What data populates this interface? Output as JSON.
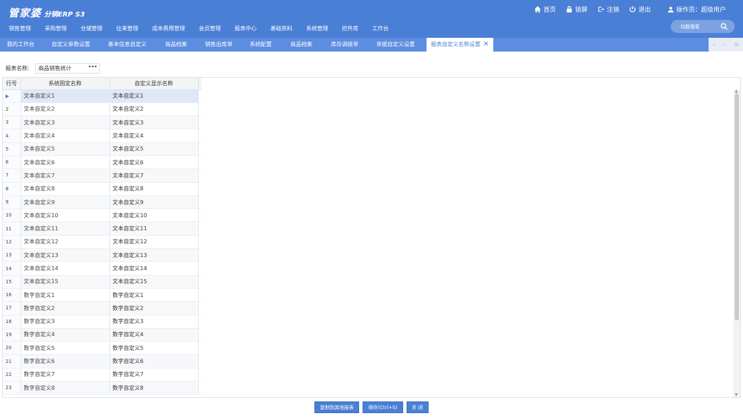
{
  "app": {
    "logo_main": "管家婆",
    "logo_sub": "分销ERP S3"
  },
  "top_links": [
    {
      "label": "首页",
      "icon": "home-icon"
    },
    {
      "label": "锁屏",
      "icon": "lock-icon"
    },
    {
      "label": "注销",
      "icon": "logout-icon"
    },
    {
      "label": "退出",
      "icon": "power-icon"
    }
  ],
  "operator": "操作员：超级用户",
  "main_menu": [
    "销售管理",
    "采购管理",
    "仓储管理",
    "往来管理",
    "成本费用管理",
    "会员管理",
    "报表中心",
    "基础资料",
    "系统管理",
    "控件库",
    "工作台"
  ],
  "search": {
    "placeholder": "功能搜索"
  },
  "tabs": [
    {
      "label": "我的工作台"
    },
    {
      "label": "自定义参数设置"
    },
    {
      "label": "基本信息自定义"
    },
    {
      "label": "商品档案"
    },
    {
      "label": "销售出库单"
    },
    {
      "label": "系统配置"
    },
    {
      "label": "商品档案"
    },
    {
      "label": "库存调拨单"
    },
    {
      "label": "单据自定义设置"
    },
    {
      "label": "报表自定义名称设置",
      "active": true
    }
  ],
  "filter": {
    "label": "报表名称:",
    "value": "商品销售统计",
    "dots": "•••"
  },
  "grid": {
    "headers": [
      "行号",
      "系统固定名称",
      "自定义显示名称"
    ],
    "selected_marker": "▶",
    "rows": [
      [
        "1",
        "文本自定义1",
        "文本自定义1"
      ],
      [
        "2",
        "文本自定义2",
        "文本自定义2"
      ],
      [
        "3",
        "文本自定义3",
        "文本自定义3"
      ],
      [
        "4",
        "文本自定义4",
        "文本自定义4"
      ],
      [
        "5",
        "文本自定义5",
        "文本自定义5"
      ],
      [
        "6",
        "文本自定义6",
        "文本自定义6"
      ],
      [
        "7",
        "文本自定义7",
        "文本自定义7"
      ],
      [
        "8",
        "文本自定义8",
        "文本自定义8"
      ],
      [
        "9",
        "文本自定义9",
        "文本自定义9"
      ],
      [
        "10",
        "文本自定义10",
        "文本自定义10"
      ],
      [
        "11",
        "文本自定义11",
        "文本自定义11"
      ],
      [
        "12",
        "文本自定义12",
        "文本自定义12"
      ],
      [
        "13",
        "文本自定义13",
        "文本自定义13"
      ],
      [
        "14",
        "文本自定义14",
        "文本自定义14"
      ],
      [
        "15",
        "文本自定义15",
        "文本自定义15"
      ],
      [
        "16",
        "数字自定义1",
        "数字自定义1"
      ],
      [
        "17",
        "数字自定义2",
        "数字自定义2"
      ],
      [
        "18",
        "数字自定义3",
        "数字自定义3"
      ],
      [
        "19",
        "数字自定义4",
        "数字自定义4"
      ],
      [
        "20",
        "数字自定义5",
        "数字自定义5"
      ],
      [
        "21",
        "数字自定义6",
        "数字自定义6"
      ],
      [
        "22",
        "数字自定义7",
        "数字自定义7"
      ],
      [
        "23",
        "数字自定义8",
        "数字自定义8"
      ]
    ]
  },
  "footer_buttons": [
    "复制到其他报表",
    "保存(Ctrl+S)",
    "关 闭"
  ],
  "colors": {
    "brand": "#4a7fd6",
    "tabbar": "#5c8de0",
    "selected_row": "#dfe8f8"
  }
}
